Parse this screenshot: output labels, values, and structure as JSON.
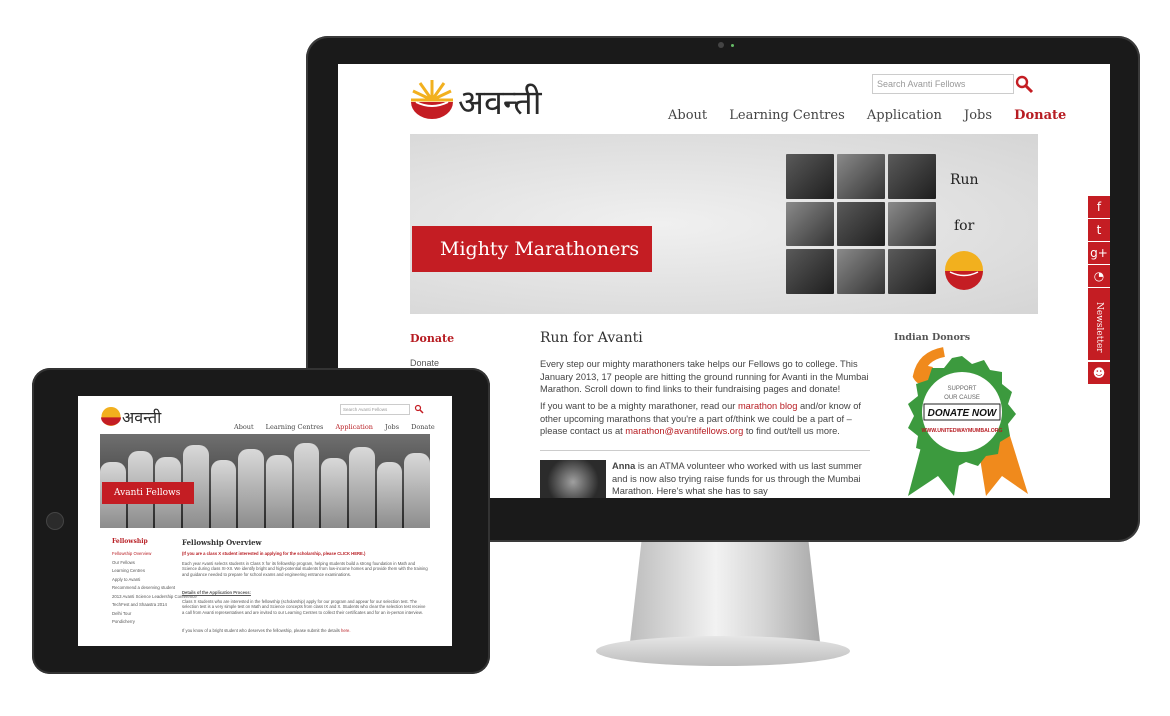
{
  "desktop": {
    "logo_text": "अवन्ती",
    "search_placeholder": "Search Avanti Fellows",
    "nav": [
      "About",
      "Learning Centres",
      "Application",
      "Jobs",
      "Donate"
    ],
    "banner": {
      "title": "Mighty Marathoners",
      "side_text_1": "Run",
      "side_text_2": "for"
    },
    "sidebar": {
      "title": "Donate",
      "items": [
        "Donate"
      ]
    },
    "main": {
      "heading": "Run for Avanti",
      "para1": "Every step our mighty marathoners take helps our Fellows go to college. This January 2013, 17 people are hitting the ground running for Avanti in the Mumbai Marathon. Scroll down to find links to their fundraising pages and donate!",
      "para2_a": "If you want to be a mighty marathoner, read our ",
      "para2_link1": "marathon blog",
      "para2_b": " and/or know of other upcoming marathons that you're a part of/think we could be a part of – please contact us at ",
      "para2_link2": "marathon@avantifellows.org",
      "para2_c": " to find out/tell us more.",
      "anna_name": "Anna",
      "anna_text": " is an ATMA volunteer who worked with us last summer and is now also trying raise funds for us through the Mumbai Marathon. Here's what she has to say"
    },
    "right": {
      "title": "Indian Donors",
      "badge_top": "SUPPORT",
      "badge_mid": "OUR CAUSE",
      "badge_cta": "DONATE NOW",
      "badge_url": "WWW.UNITEDWAYMUMBAI.ORG"
    },
    "social": {
      "icons": [
        "f",
        "t",
        "g+",
        "rss"
      ],
      "newsletter": "Newsletter"
    }
  },
  "tablet": {
    "logo_text": "अवन्ती",
    "search_placeholder": "Search Avanti Fellows",
    "nav": [
      "About",
      "Learning Centres",
      "Application",
      "Jobs",
      "Donate"
    ],
    "banner_title": "Avanti Fellows",
    "sidebar_title": "Fellowship",
    "sidebar_items": [
      "Fellowship Overview",
      "Our Fellows",
      "Learning Centres",
      "Apply to Avanti",
      "Recommend a deserving student",
      "2013 Avanti Science Leadership Conference",
      "TechFest and Shaastra 2014",
      "Delhi Tour",
      "Pondicherry"
    ],
    "heading": "Fellowship Overview",
    "note": "(If you are a class X student interested in applying for the scholarship, please CLICK HERE.)",
    "para1": "Each year Avanti selects students in Class X for its fellowship program, helping students build a strong foundation in Math and Science during class XI-XII. We identify bright and high-potential students from low-income homes and provide them with the training and guidance needed to prepare for school exams and engineering entrance examinations.",
    "subhead": "Details of the Application Process:",
    "para2": "Class X students who are interested in the fellowship (scholarship) apply for our program and appear for our selection test. The selection test is a very simple test on Math and Science concepts from class IX and X. Students who clear the selection test receive a call from Avanti representatives and are invited to our Learning Centres to collect their certificates and for an in-person interview.",
    "para3_a": "If you know of a bright student who deserves the fellowship, please submit the details ",
    "para3_link": "here."
  }
}
